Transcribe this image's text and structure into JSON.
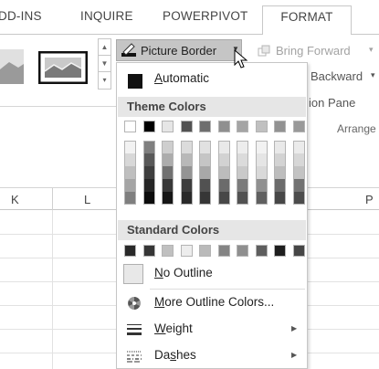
{
  "ribbon_tabs": [
    "DD-INS",
    "INQUIRE",
    "POWERPIVOT",
    "FORMAT"
  ],
  "active_tab": "FORMAT",
  "ribbon": {
    "picture_border_label": "Picture Border",
    "bring_forward_label": "Bring Forward",
    "send_backward_label": "Backward",
    "selection_pane_label": "ion Pane",
    "arrange_group_label": "Arrange"
  },
  "sheet": {
    "columns": [
      "K",
      "L",
      "P"
    ]
  },
  "dropdown": {
    "automatic_label": "Automatic",
    "theme_colors_header": "Theme Colors",
    "standard_colors_header": "Standard Colors",
    "no_outline_label": "No Outline",
    "more_outline_colors_label": "More Outline Colors...",
    "weight_label": "Weight",
    "dashes_label": "Dashes"
  },
  "theme_colors": {
    "top_row": [
      "#ffffff",
      "#000000",
      "#e7e6e6",
      "#44546a",
      "#4472c4",
      "#ed7d31",
      "#a5a5a5",
      "#ffc000",
      "#5b9bd5",
      "#70ad47"
    ],
    "shades": [
      [
        "#f2f2f2",
        "#7f7f7f",
        "#d0cece",
        "#d6dce4",
        "#d9e2f3",
        "#fbe5d5",
        "#ededed",
        "#fff2cc",
        "#deebf6",
        "#e2efd9"
      ],
      [
        "#d8d8d8",
        "#595959",
        "#aeabab",
        "#adb9ca",
        "#b4c6e7",
        "#f7cbac",
        "#dbdbdb",
        "#fee599",
        "#bdd7ee",
        "#c5e0b3"
      ],
      [
        "#bfbfbf",
        "#3f3f3f",
        "#757070",
        "#8496b0",
        "#8eaadb",
        "#f4b183",
        "#c9c9c9",
        "#ffd966",
        "#9cc3e5",
        "#a8d08d"
      ],
      [
        "#a5a5a5",
        "#262626",
        "#3a3838",
        "#323f4f",
        "#2f5496",
        "#c55a11",
        "#7b7b7b",
        "#bf9000",
        "#2e75b5",
        "#538135"
      ],
      [
        "#7f7f7f",
        "#0c0c0c",
        "#171616",
        "#222a35",
        "#1e3864",
        "#843c0c",
        "#525252",
        "#7f6000",
        "#1f4e79",
        "#375623"
      ]
    ]
  },
  "standard_colors": [
    "#c00000",
    "#ff0000",
    "#ffc000",
    "#ffff00",
    "#92d050",
    "#00b050",
    "#00b0f0",
    "#0070c0",
    "#002060",
    "#7030a0"
  ],
  "icons": {
    "picture_border": "pen-border-icon",
    "bring_forward": "bring-forward-icon",
    "more_colors": "color-wheel-icon",
    "weight": "line-weight-icon",
    "dashes": "dashes-icon",
    "cursor": "mouse-pointer-icon"
  }
}
